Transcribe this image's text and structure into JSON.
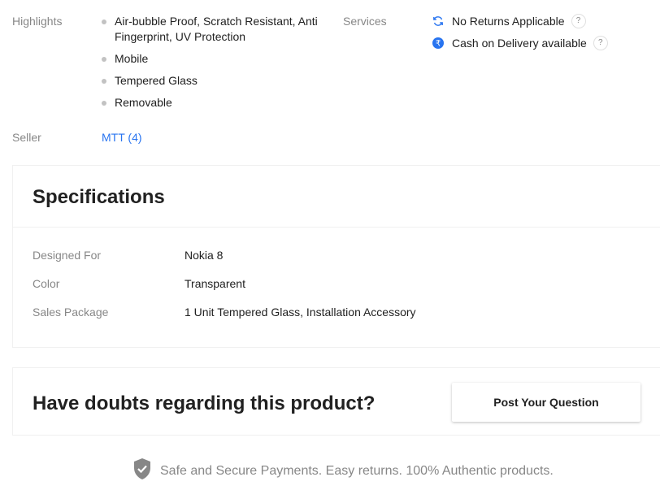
{
  "highlights": {
    "label": "Highlights",
    "items": [
      "Air-bubble Proof, Scratch Resistant, Anti Fingerprint, UV Protection",
      "Mobile",
      "Tempered Glass",
      "Removable"
    ]
  },
  "services": {
    "label": "Services",
    "items": [
      {
        "text": "No Returns Applicable",
        "icon": "refresh-icon",
        "help": "?"
      },
      {
        "text": "Cash on Delivery available",
        "icon": "rupee-icon",
        "help": "?"
      }
    ]
  },
  "seller": {
    "label": "Seller",
    "value": "MTT (4)"
  },
  "specifications": {
    "title": "Specifications",
    "rows": [
      {
        "key": "Designed For",
        "value": "Nokia 8"
      },
      {
        "key": "Color",
        "value": "Transparent"
      },
      {
        "key": "Sales Package",
        "value": "1 Unit Tempered Glass, Installation Accessory"
      }
    ]
  },
  "questions": {
    "title": "Have doubts regarding this product?",
    "button_label": "Post Your Question"
  },
  "footer": {
    "text": "Safe and Secure Payments. Easy returns. 100% Authentic products.",
    "icon": "shield-check-icon"
  },
  "colors": {
    "link": "#2874f0",
    "muted": "#878787",
    "text": "#212121"
  }
}
